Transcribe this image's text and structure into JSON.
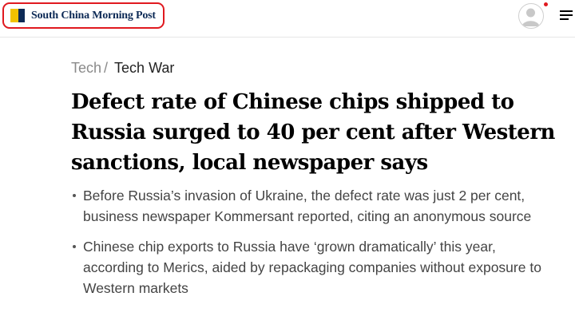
{
  "header": {
    "logo_text": "South China Morning Post",
    "logo_colors": {
      "yellow": "#f2c200",
      "navy": "#0d2a56"
    },
    "highlight_color": "#e0191f",
    "avatar_icon": "user-avatar-icon",
    "menu_icon": "hamburger-menu-icon"
  },
  "breadcrumb": {
    "section": "Tech",
    "separator": "/",
    "topic": "Tech War"
  },
  "article": {
    "headline": "Defect rate of Chinese chips shipped to Russia surged to 40 per cent after Western sanctions, local newspaper says",
    "summary": [
      "Before Russia’s invasion of Ukraine, the defect rate was just 2 per cent, business newspaper Kommersant reported, citing an anonymous source",
      "Chinese chip exports to Russia have ‘grown dramatically’ this year, according to Merics, aided by repackaging companies without exposure to Western markets"
    ]
  }
}
